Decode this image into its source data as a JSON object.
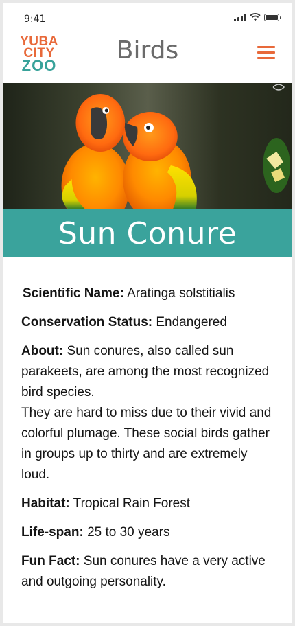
{
  "status_bar": {
    "time": "9:41"
  },
  "header": {
    "logo": {
      "line1": "YUBA",
      "line2": "CITY",
      "line3": "ZOO"
    },
    "title": "Birds",
    "menu_icon": "hamburger-menu-icon"
  },
  "hero": {
    "image": "two-sun-conure-parrots-photo"
  },
  "banner": {
    "title": "Sun Conure"
  },
  "details": {
    "scientific_name": {
      "label": "Scientific Name:",
      "value": "Aratinga solstitialis"
    },
    "conservation_status": {
      "label": "Conservation Status:",
      "value": "Endangered"
    },
    "about": {
      "label": "About:",
      "value1": "Sun conures, also called sun parakeets, are among the most recognized bird species.",
      "value2": "They are hard to miss due to their vivid and colorful plumage. These social birds gather in groups up to thirty and are extremely loud."
    },
    "habitat": {
      "label": "Habitat:",
      "value": "Tropical Rain Forest"
    },
    "life_span": {
      "label": "Life-span:",
      "value": "25 to 30 years"
    },
    "fun_fact": {
      "label": "Fun Fact:",
      "value": "Sun conures have a very active and outgoing personality."
    }
  },
  "colors": {
    "accent": "#e8693a",
    "teal": "#3aa39c",
    "title_gray": "#6b6b6b"
  }
}
